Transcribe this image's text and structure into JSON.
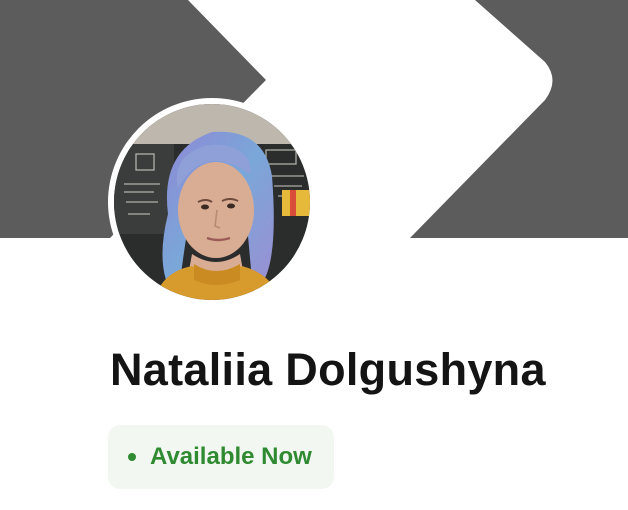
{
  "profile": {
    "name": "Nataliia Dolgushyna",
    "avatar_alt": "profile-photo",
    "status": {
      "label": "Available Now",
      "color": "#2f8a31",
      "background": "#f2f8f1"
    }
  },
  "cover": {
    "background_color": "#5c5c5c",
    "shape_color": "#ffffff",
    "shape_icon": "chevron-right-icon"
  }
}
